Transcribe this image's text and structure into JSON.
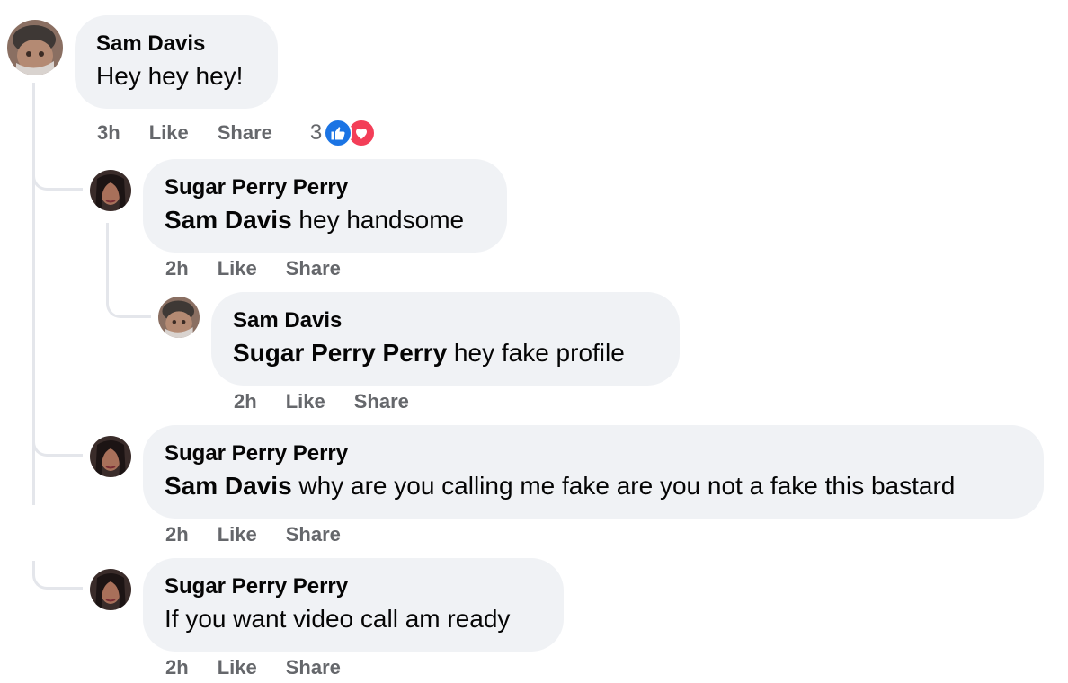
{
  "colors": {
    "bubble": "#f0f2f5",
    "meta": "#65676b",
    "like": "#1b74e4",
    "love": "#f33e58",
    "thread_line": "#e4e6eb"
  },
  "comments": [
    {
      "author": "Sam Davis",
      "mention": "",
      "text": "Hey hey hey!",
      "time": "3h",
      "like": "Like",
      "share": "Share",
      "reaction_count": "3",
      "reaction_icons": [
        "like-icon",
        "love-icon"
      ]
    },
    {
      "author": "Sugar Perry Perry",
      "mention": "Sam Davis",
      "text": " hey handsome",
      "time": "2h",
      "like": "Like",
      "share": "Share"
    },
    {
      "author": "Sam Davis",
      "mention": "Sugar Perry Perry",
      "text": " hey fake profile",
      "time": "2h",
      "like": "Like",
      "share": "Share"
    },
    {
      "author": "Sugar Perry Perry",
      "mention": "Sam Davis",
      "text": " why are you calling me fake are you not a fake this bastard",
      "time": "2h",
      "like": "Like",
      "share": "Share"
    },
    {
      "author": "Sugar Perry Perry",
      "mention": "",
      "text": "If you want video call am ready",
      "time": "2h",
      "like": "Like",
      "share": "Share"
    }
  ]
}
